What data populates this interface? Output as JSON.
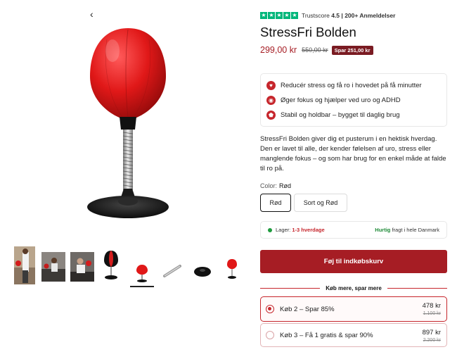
{
  "gallery": {
    "back_icon": "chevron-left-icon",
    "thumbnails": [
      {
        "name": "thumb-person-punching-1",
        "active": false
      },
      {
        "name": "thumb-man-office-couch",
        "active": false
      },
      {
        "name": "thumb-man-at-desk",
        "active": false
      },
      {
        "name": "thumb-black-red-ball",
        "active": false
      },
      {
        "name": "thumb-red-ball",
        "active": true
      },
      {
        "name": "thumb-spring-rod",
        "active": false
      },
      {
        "name": "thumb-suction-base",
        "active": false
      },
      {
        "name": "thumb-red-ball-small",
        "active": false
      }
    ]
  },
  "rating": {
    "stars": [
      "★",
      "★",
      "★",
      "★",
      "★"
    ],
    "label": "Trustscore",
    "score": "4.5",
    "separator": "|",
    "reviews": "200+ Anmeldelser",
    "star_color": "#00b67a"
  },
  "product": {
    "title": "StressFri Bolden",
    "price": "299,00 kr",
    "old_price": "550,00 kr",
    "save_badge": "Spar 251,00 kr"
  },
  "benefits": [
    {
      "icon": "heart-icon",
      "glyph": "♥",
      "text": "Reducér stress og få ro i hovedet på få minutter"
    },
    {
      "icon": "brain-icon",
      "glyph": "◉",
      "text": "Øger fokus og hjælper ved uro og ADHD"
    },
    {
      "icon": "shield-icon",
      "glyph": "⬟",
      "text": "Stabil og holdbar – bygget til daglig brug"
    }
  ],
  "description": "StressFri Bolden giver dig et pusterum i en hektisk hverdag. Den er lavet til alle, der kender følelsen af uro, stress eller manglende fokus – og som har brug for en enkel måde at falde til ro på.",
  "color": {
    "label": "Color:",
    "selected": "Rød",
    "options": [
      "Rød",
      "Sort og Rød"
    ]
  },
  "stock": {
    "label": "Lager:",
    "value": "1-3 hverdage",
    "shipping_strong": "Hurtig",
    "shipping_rest": "fragt i hele Danmark"
  },
  "cart": {
    "button_label": "Føj til indkøbskurv"
  },
  "bundles": {
    "heading": "Køb mere, spar mere",
    "options": [
      {
        "label": "Køb 2 – Spar 85%",
        "price": "478 kr",
        "old_price": "1.100 kr",
        "selected": true
      },
      {
        "label": "Køb 3 – Få 1 gratis & spar 90%",
        "price": "897 kr",
        "old_price": "2.200 kr",
        "selected": false
      }
    ]
  },
  "colors": {
    "accent": "#a61d24",
    "badge": "#7a1b22",
    "trust_green": "#00b67a",
    "stock_green": "#1e9b3d"
  }
}
